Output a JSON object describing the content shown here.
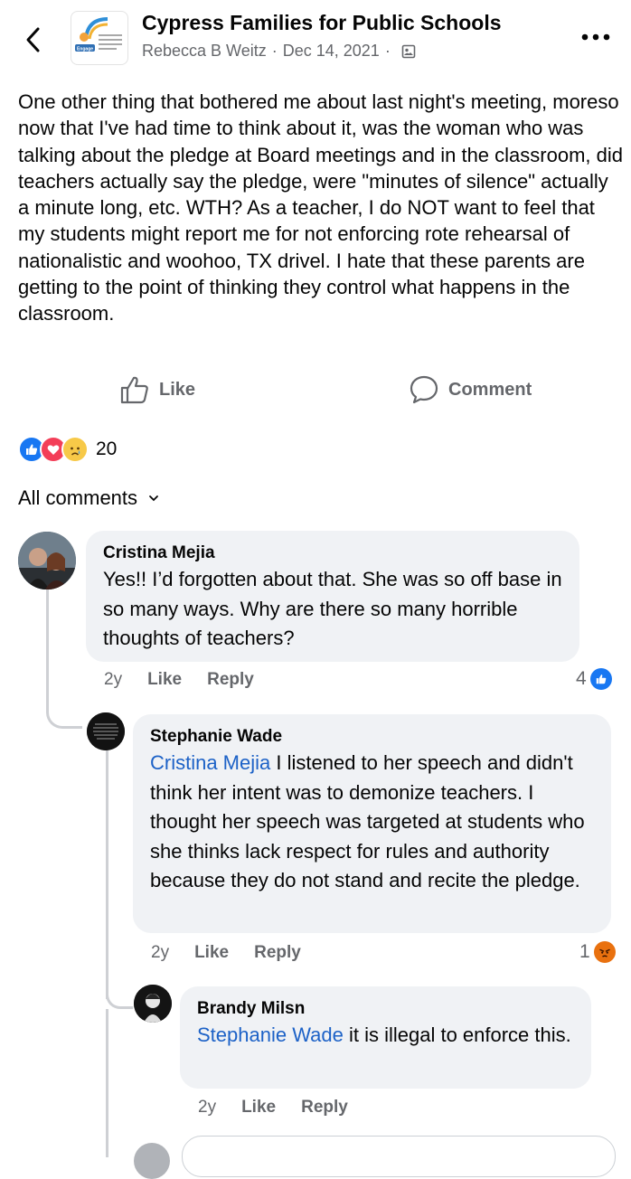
{
  "header": {
    "group_name": "Cypress Families for Public Schools",
    "author": "Rebecca B Weitz",
    "date": "Dec 14, 2021",
    "separator": "·",
    "group_avatar_text": "Engage"
  },
  "post": {
    "body": "One other thing that bothered me about last night's meeting, moreso now that I've had time to think about it, was the woman who was talking about the pledge at Board meetings and in the classroom, did teachers actually say the pledge, were \"minutes of silence\" actually a minute long, etc. WTH? As a teacher, I do NOT want to feel that my students might report me for not enforcing rote rehearsal of nationalistic and woohoo, TX drivel. I hate that these parents are getting to the point of thinking they control what happens in the classroom."
  },
  "actions": {
    "like": "Like",
    "comment": "Comment"
  },
  "reactions": {
    "count": "20",
    "types": [
      "like",
      "love",
      "sad"
    ]
  },
  "comments_filter": {
    "label": "All comments"
  },
  "comments": [
    {
      "name": "Cristina Mejia",
      "text": "Yes!! I’d forgotten about that. She was so off base in so many ways. Why are there so many horrible thoughts of teachers?",
      "time": "2y",
      "like": "Like",
      "reply": "Reply",
      "reaction_count": "4",
      "reaction_type": "like"
    },
    {
      "name": "Stephanie Wade",
      "mention": "Cristina Mejia",
      "text": " I listened to her speech and didn't think her intent was to demonize teachers. I thought her speech was targeted at students who she thinks lack respect for rules and authority because they do not stand and recite the pledge.",
      "time": "2y",
      "like": "Like",
      "reply": "Reply",
      "reaction_count": "1",
      "reaction_type": "angry"
    },
    {
      "name": "Brandy Milsn",
      "mention": "Stephanie Wade",
      "text": " it is illegal to enforce this.",
      "time": "2y",
      "like": "Like",
      "reply": "Reply"
    }
  ],
  "colors": {
    "accent": "#1877f2",
    "mention": "#1d62c7",
    "bubble": "#f0f2f5",
    "secondary_text": "#65676b",
    "love": "#f33e58",
    "angry": "#e9710f"
  },
  "icons": [
    "back-arrow-icon",
    "more-icon",
    "privacy-icon",
    "like-icon",
    "comment-icon",
    "chevron-down-icon"
  ]
}
